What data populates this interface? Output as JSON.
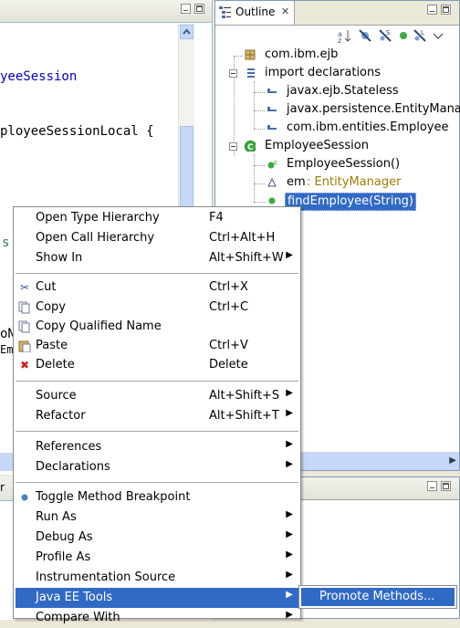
{
  "editor": {
    "code_lines": [
      {
        "text": "yeeSession",
        "style": "type"
      },
      {
        "text": "ployeeSessionLocal {",
        "style": "plain"
      },
      {
        "text": "s",
        "style": "plain"
      },
      {
        "text": "oN",
        "style": "plain"
      },
      {
        "text": "Em",
        "style": "plain"
      }
    ],
    "bottom_tab_fragment": "r"
  },
  "outline": {
    "tab_label": "Outline",
    "tab_close": "✕",
    "toolbar_icons": [
      "sort-az-icon",
      "hide-fields-icon",
      "hide-static-icon",
      "hide-nonpublic-icon",
      "hide-local-types-icon",
      "view-menu-icon"
    ],
    "tree": [
      {
        "label": "com.ibm.ejb",
        "type": "package"
      },
      {
        "label": "import declarations",
        "type": "imports"
      },
      {
        "label": "javax.ejb.Stateless",
        "type": "import"
      },
      {
        "label": "javax.persistence.EntityManag",
        "type": "import"
      },
      {
        "label": "com.ibm.entities.Employee",
        "type": "import"
      },
      {
        "label": "EmployeeSession",
        "type": "class"
      },
      {
        "label": "EmployeeSession()",
        "type": "constructor"
      },
      {
        "label": "em",
        "type": "field",
        "suffix": " : EntityManager"
      },
      {
        "label": "findEmployee(String)",
        "type": "method",
        "selected": true
      }
    ]
  },
  "context_menu": {
    "groups": [
      [
        {
          "label": "Open Type Hierarchy",
          "shortcut": "F4",
          "submenu": false,
          "icon": ""
        },
        {
          "label": "Open Call Hierarchy",
          "shortcut": "Ctrl+Alt+H",
          "submenu": false,
          "icon": ""
        },
        {
          "label": "Show In",
          "shortcut": "Alt+Shift+W",
          "submenu": true,
          "icon": ""
        }
      ],
      [
        {
          "label": "Cut",
          "shortcut": "Ctrl+X",
          "submenu": false,
          "icon": "scissors-icon"
        },
        {
          "label": "Copy",
          "shortcut": "Ctrl+C",
          "submenu": false,
          "icon": "copy-icon"
        },
        {
          "label": "Copy Qualified Name",
          "shortcut": "",
          "submenu": false,
          "icon": "copy-qualified-icon"
        },
        {
          "label": "Paste",
          "shortcut": "Ctrl+V",
          "submenu": false,
          "icon": "paste-icon"
        },
        {
          "label": "Delete",
          "shortcut": "Delete",
          "submenu": false,
          "icon": "delete-icon"
        }
      ],
      [
        {
          "label": "Source",
          "shortcut": "Alt+Shift+S",
          "submenu": true,
          "icon": ""
        },
        {
          "label": "Refactor",
          "shortcut": "Alt+Shift+T",
          "submenu": true,
          "icon": ""
        }
      ],
      [
        {
          "label": "References",
          "shortcut": "",
          "submenu": true,
          "icon": ""
        },
        {
          "label": "Declarations",
          "shortcut": "",
          "submenu": true,
          "icon": ""
        }
      ],
      [
        {
          "label": "Toggle Method Breakpoint",
          "shortcut": "",
          "submenu": false,
          "icon": "breakpoint-icon"
        },
        {
          "label": "Run As",
          "shortcut": "",
          "submenu": true,
          "icon": ""
        },
        {
          "label": "Debug As",
          "shortcut": "",
          "submenu": true,
          "icon": ""
        },
        {
          "label": "Profile As",
          "shortcut": "",
          "submenu": true,
          "icon": ""
        },
        {
          "label": "Instrumentation Source",
          "shortcut": "",
          "submenu": true,
          "icon": ""
        },
        {
          "label": "Java EE Tools",
          "shortcut": "",
          "submenu": true,
          "icon": "",
          "selected": true
        },
        {
          "label": "Compare With",
          "shortcut": "",
          "submenu": true,
          "icon": ""
        }
      ]
    ]
  },
  "submenu": {
    "items": [
      {
        "label": "Promote Methods...",
        "selected": true
      }
    ]
  },
  "colors": {
    "selection": "#316ac5",
    "type_text": "#0000c0",
    "field_type": "#9e7c00",
    "breakpoint": "#4b7fbf",
    "delete": "#d02020"
  }
}
